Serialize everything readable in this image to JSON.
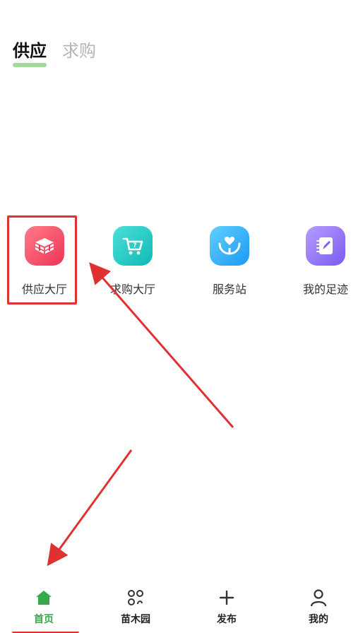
{
  "top_tabs": [
    {
      "label": "供应",
      "active": true
    },
    {
      "label": "求购",
      "active": false
    }
  ],
  "grid": [
    {
      "label": "供应大厅",
      "icon": "supply-hall-icon",
      "color": "#ee3454"
    },
    {
      "label": "求购大厅",
      "icon": "cart-question-icon",
      "color": "#12b9b5"
    },
    {
      "label": "服务站",
      "icon": "service-hands-icon",
      "color": "#1d99f2"
    },
    {
      "label": "我的足迹",
      "icon": "notebook-pen-icon",
      "color": "#7a5cf0"
    }
  ],
  "bottom_nav": [
    {
      "label": "首页",
      "icon": "home-icon",
      "active": true
    },
    {
      "label": "苗木园",
      "icon": "garden-circles-icon",
      "active": false
    },
    {
      "label": "发布",
      "icon": "plus-icon",
      "active": false
    },
    {
      "label": "我的",
      "icon": "user-icon",
      "active": false
    }
  ],
  "colors": {
    "accent_green": "#35a94b",
    "annotation_red": "#e03131"
  }
}
